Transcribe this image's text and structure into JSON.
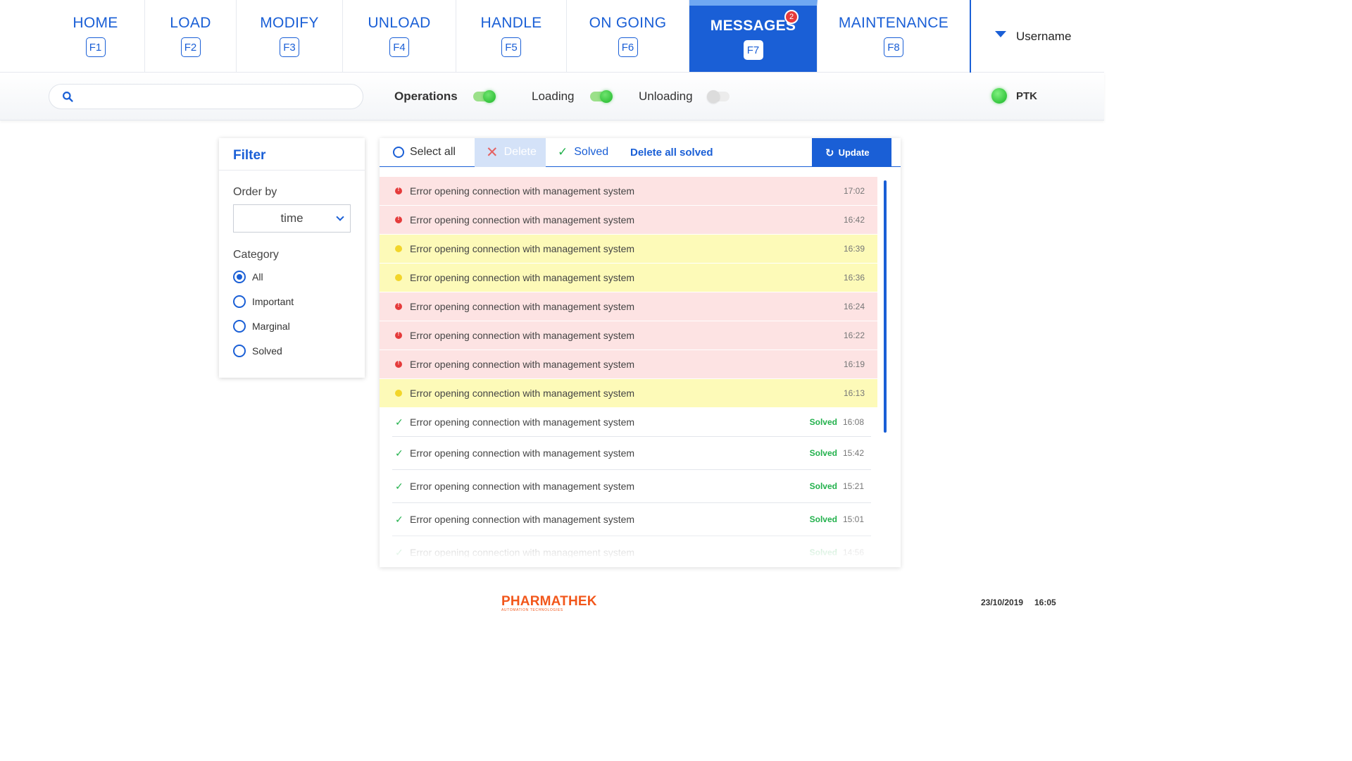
{
  "nav": {
    "tabs": [
      {
        "label": "HOME",
        "key": "F1"
      },
      {
        "label": "LOAD",
        "key": "F2"
      },
      {
        "label": "MODIFY",
        "key": "F3"
      },
      {
        "label": "UNLOAD",
        "key": "F4"
      },
      {
        "label": "HANDLE",
        "key": "F5"
      },
      {
        "label": "ON GOING",
        "key": "F6"
      },
      {
        "label": "MESSAGES",
        "key": "F7",
        "active": true,
        "badge": "2"
      },
      {
        "label": "MAINTENANCE",
        "key": "F8"
      }
    ],
    "username": "Username"
  },
  "toolbar": {
    "search": {
      "value": "",
      "placeholder": ""
    },
    "toggles": [
      {
        "label": "Operations",
        "on": true
      },
      {
        "label": "Loading",
        "on": true
      },
      {
        "label": "Unloading",
        "on": false
      }
    ],
    "status": {
      "label": "PTK",
      "color": "#22c030"
    }
  },
  "filter": {
    "title": "Filter",
    "order_by_label": "Order by",
    "order_by_value": "time",
    "category_label": "Category",
    "categories": [
      {
        "label": "All",
        "checked": true
      },
      {
        "label": "Important",
        "checked": false
      },
      {
        "label": "Marginal",
        "checked": false
      },
      {
        "label": "Solved",
        "checked": false
      }
    ]
  },
  "actions": {
    "select_all": "Select all",
    "delete": "Delete",
    "solved": "Solved",
    "delete_all_solved": "Delete all solved",
    "update": "Update"
  },
  "messages": [
    {
      "text": "Error opening connection with management system",
      "time": "17:02",
      "level": "error"
    },
    {
      "text": "Error opening connection with management system",
      "time": "16:42",
      "level": "error"
    },
    {
      "text": "Error opening connection with management system",
      "time": "16:39",
      "level": "warning"
    },
    {
      "text": "Error opening connection with management system",
      "time": "16:36",
      "level": "warning"
    },
    {
      "text": "Error opening connection with management system",
      "time": "16:24",
      "level": "error"
    },
    {
      "text": "Error opening connection with management system",
      "time": "16:22",
      "level": "error"
    },
    {
      "text": "Error opening connection with management system",
      "time": "16:19",
      "level": "error"
    },
    {
      "text": "Error opening connection with management system",
      "time": "16:13",
      "level": "warning"
    },
    {
      "text": "Error opening connection with management system",
      "time": "16:08",
      "level": "solved",
      "status": "Solved"
    },
    {
      "text": "Error opening connection with management system",
      "time": "15:42",
      "level": "solved",
      "status": "Solved"
    },
    {
      "text": "Error opening connection with management system",
      "time": "15:21",
      "level": "solved",
      "status": "Solved"
    },
    {
      "text": "Error opening connection with management system",
      "time": "15:01",
      "level": "solved",
      "status": "Solved"
    },
    {
      "text": "Error opening connection with management system",
      "time": "14:56",
      "level": "solved",
      "status": "Solved"
    }
  ],
  "footer": {
    "brand": "PHARMATHEK",
    "tagline": "AUTOMATION TECHNOLOGIES",
    "date": "23/10/2019",
    "time": "16:05"
  },
  "colors": {
    "accent": "#1a5fd6",
    "error_row": "#fde3e3",
    "warning_row": "#fdfab8",
    "solved_text": "#22b14c",
    "brand": "#f2571b"
  }
}
